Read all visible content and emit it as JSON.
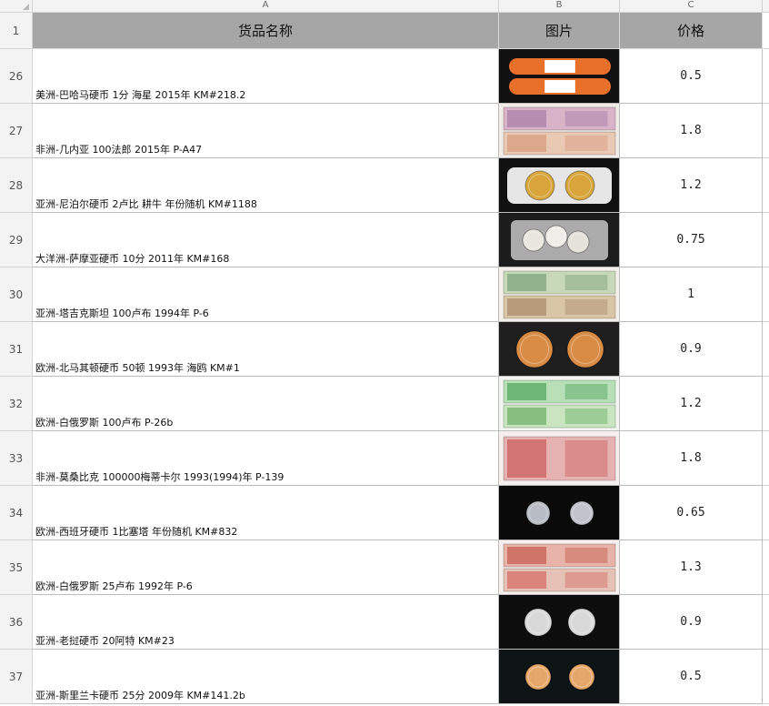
{
  "columns": [
    "A",
    "B",
    "C"
  ],
  "header": {
    "row_number": "1",
    "name": "货品名称",
    "image": "图片",
    "price": "价格"
  },
  "rows": [
    {
      "num": "26",
      "name": "美洲-巴哈马硬币 1分 海星 2015年 KM#218.2",
      "price": "0.5",
      "image": "coin-rolls-bahamas",
      "bg": "#111111"
    },
    {
      "num": "27",
      "name": "非洲-几内亚 100法郎 2015年 P-A47",
      "price": "1.8",
      "image": "banknote-guinea",
      "bg": "#f2ece9"
    },
    {
      "num": "28",
      "name": "亚洲-尼泊尔硬币 2卢比 耕牛 年份随机 KM#1188",
      "price": "1.2",
      "image": "coin-rolls-nepal",
      "bg": "#111111"
    },
    {
      "num": "29",
      "name": "大洋洲-萨摩亚硬币 10分 2011年 KM#168",
      "price": "0.75",
      "image": "coin-bag-samoa",
      "bg": "#1c1c1c"
    },
    {
      "num": "30",
      "name": "亚洲-塔吉克斯坦 100卢布 1994年 P-6",
      "price": "1",
      "image": "banknote-tajikistan",
      "bg": "#f5f1ea"
    },
    {
      "num": "31",
      "name": "欧洲-北马其顿硬币 50顿 1993年 海鸥 KM#1",
      "price": "0.9",
      "image": "coin-macedonia",
      "bg": "#1e1e1e"
    },
    {
      "num": "32",
      "name": "欧洲-白俄罗斯 100卢布 P-26b",
      "price": "1.2",
      "image": "banknote-belarus-100",
      "bg": "#f3f5f0"
    },
    {
      "num": "33",
      "name": "非洲-莫桑比克 100000梅蒂卡尔 1993(1994)年 P-139",
      "price": "1.8",
      "image": "banknote-mozambique",
      "bg": "#f6efec"
    },
    {
      "num": "34",
      "name": "欧洲-西班牙硬币 1比塞塔 年份随机 KM#832",
      "price": "0.65",
      "image": "coin-spain",
      "bg": "#0a0a0a"
    },
    {
      "num": "35",
      "name": "欧洲-白俄罗斯 25卢布 1992年 P-6",
      "price": "1.3",
      "image": "banknote-belarus-25",
      "bg": "#f6efec"
    },
    {
      "num": "36",
      "name": "亚洲-老挝硬币 20阿特 KM#23",
      "price": "0.9",
      "image": "coin-laos",
      "bg": "#0d0d0d"
    },
    {
      "num": "37",
      "name": "亚洲-斯里兰卡硬币 25分 2009年 KM#141.2b",
      "price": "0.5",
      "image": "coin-sri-lanka",
      "bg": "#0e1416"
    }
  ]
}
